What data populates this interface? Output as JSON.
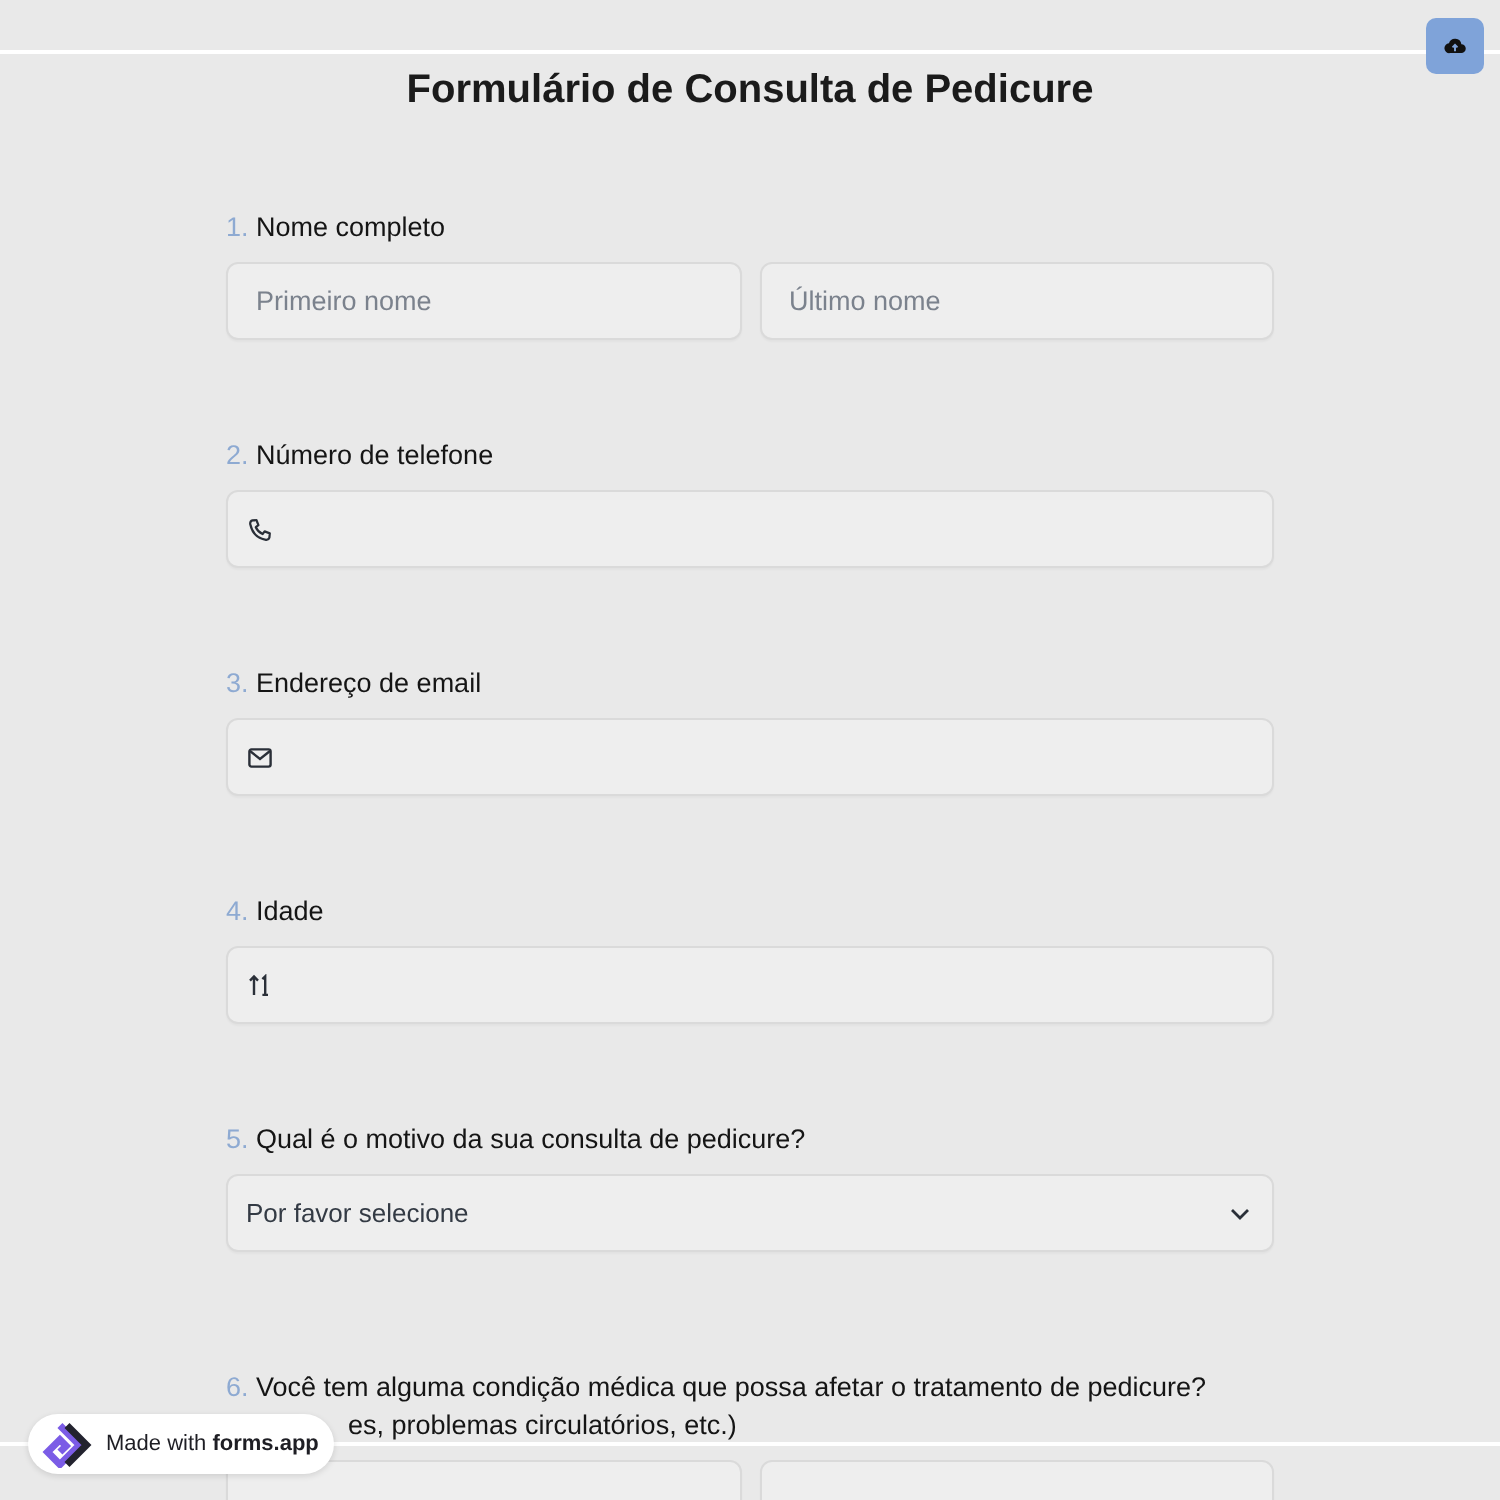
{
  "title": "Formulário de Consulta de Pedicure",
  "questions": [
    {
      "number": "1.",
      "label": "Nome completo",
      "fields": [
        {
          "kind": "text",
          "placeholder": "Primeiro nome"
        },
        {
          "kind": "text",
          "placeholder": "Último nome"
        }
      ]
    },
    {
      "number": "2.",
      "label": "Número de telefone",
      "fields": [
        {
          "kind": "phone"
        }
      ]
    },
    {
      "number": "3.",
      "label": "Endereço de email",
      "fields": [
        {
          "kind": "email"
        }
      ]
    },
    {
      "number": "4.",
      "label": "Idade",
      "fields": [
        {
          "kind": "number"
        }
      ]
    },
    {
      "number": "5.",
      "label": "Qual é o motivo da sua consulta de pedicure?",
      "fields": [
        {
          "kind": "select",
          "placeholder": "Por favor selecione"
        }
      ]
    },
    {
      "number": "6.",
      "label": "Você tem alguma condição médica que possa afetar o tratamento de pedicure?",
      "label_line_2": "es, problemas circulatórios, etc.)",
      "fields": [
        {
          "kind": "option"
        },
        {
          "kind": "option"
        }
      ]
    }
  ],
  "badge": {
    "text": "Made with **forms.app**"
  }
}
